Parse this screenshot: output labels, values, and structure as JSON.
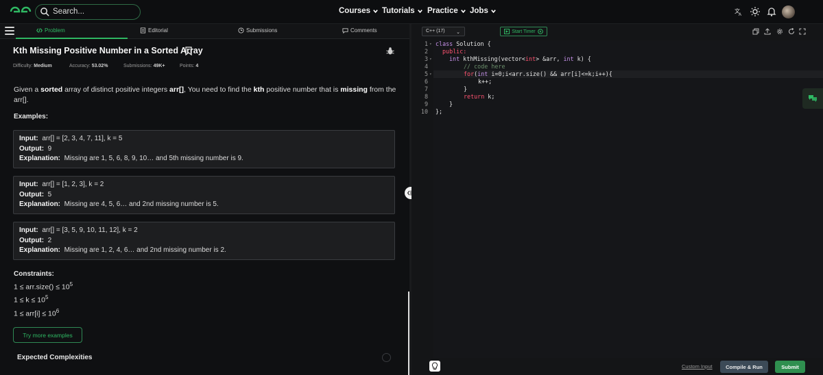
{
  "topbar": {
    "search_placeholder": "Search...",
    "nav": [
      "Courses",
      "Tutorials",
      "Practice",
      "Jobs"
    ],
    "icons": [
      "translate-icon",
      "theme-icon",
      "bell-icon"
    ]
  },
  "left": {
    "tabs": [
      "Problem",
      "Editorial",
      "Submissions",
      "Comments"
    ],
    "title": "Kth Missing Positive Number in a Sorted Array",
    "meta": {
      "difficulty_label": "Difficulty:",
      "difficulty": "Medium",
      "accuracy_label": "Accuracy:",
      "accuracy": "53.02%",
      "submissions_label": "Submissions:",
      "submissions": "49K+",
      "points_label": "Points:",
      "points": "4"
    },
    "desc": {
      "p1": "Given a ",
      "b1": "sorted",
      "p2": " array of distinct positive integers ",
      "b2": "arr[]",
      "p3": ", You need to find the ",
      "b3": "kth",
      "p4": " positive number that is ",
      "b4": "missing",
      "p5": " from the arr[]."
    },
    "examples_heading": "Examples:",
    "examples": [
      {
        "input_label": "Input:",
        "input": "arr[] = [2, 3, 4, 7, 11], k = 5",
        "output_label": "Output:",
        "output": "9",
        "explanation_label": "Explanation:",
        "explanation": "Missing are 1, 5, 6, 8, 9, 10… and 5th missing number is 9."
      },
      {
        "input_label": "Input:",
        "input": "arr[] = [1, 2, 3], k = 2",
        "output_label": "Output:",
        "output": "5",
        "explanation_label": "Explanation:",
        "explanation": "Missing are 4, 5, 6… and 2nd missing number is 5."
      },
      {
        "input_label": "Input:",
        "input": "arr[] = [3, 5, 9, 10, 11, 12], k = 2",
        "output_label": "Output:",
        "output": "2",
        "explanation_label": "Explanation:",
        "explanation": "Missing are 1, 2, 4, 6… and 2nd missing number is 2."
      }
    ],
    "constraints_heading": "Constraints:",
    "constraints": [
      {
        "base": "1 ≤ arr.size() ≤ 10",
        "exp": "5"
      },
      {
        "base": "1 ≤ k ≤ 10",
        "exp": "5"
      },
      {
        "base": "1 ≤ arr[i] ≤ 10",
        "exp": "6"
      }
    ],
    "more_button": "Try more examples",
    "complexities_heading": "Expected Complexities"
  },
  "right": {
    "language": "C++ (17)",
    "timer": "Start Timer",
    "line_numbers": [
      "1",
      "2",
      "3",
      "4",
      "5",
      "6",
      "7",
      "8",
      "9",
      "10"
    ],
    "code": {
      "l1_kw": "class",
      "l1_rest": " Solution {",
      "l2": "public:",
      "l3_kw": "int",
      "l3_a": " kthMissing(vector<",
      "l3_t": "int",
      "l3_b": "> &arr, ",
      "l3_kw2": "int",
      "l3_c": " k) {",
      "l4": "// code here",
      "l5_kw": "for",
      "l5_a": "(",
      "l5_t": "int",
      "l5_b": " i=0;i<arr.size() && arr[i]<=k;i++){",
      "l6": "k++;",
      "l7": "}",
      "l8_kw": "return",
      "l8_rest": " k;",
      "l9": "}",
      "l10": "};"
    },
    "custom_input": "Custom Input",
    "compile": "Compile & Run",
    "submit": "Submit"
  }
}
